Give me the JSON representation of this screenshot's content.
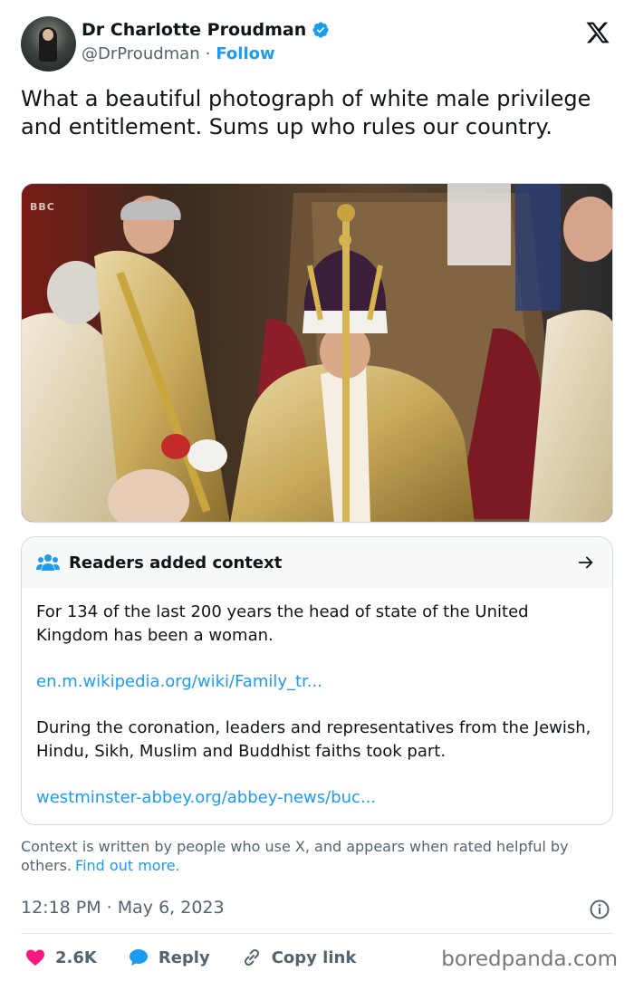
{
  "author": {
    "name": "Dr Charlotte Proudman",
    "handle": "@DrProudman",
    "separator": "·",
    "follow_label": "Follow"
  },
  "tweet": {
    "text": "What a beautiful photograph of white male privilege and entitlement. Sums up who rules our country.",
    "photo_overlay_text": "BBC"
  },
  "context": {
    "title": "Readers added context",
    "paragraph1": "For 134 of the last 200 years the head of state of the United Kingdom has been a woman.",
    "link1": "en.m.wikipedia.org/wiki/Family_tr...",
    "paragraph2": "During the coronation, leaders and representatives from the Jewish, Hindu, Sikh, Muslim and Buddhist faiths took part.",
    "link2": "westminster-abbey.org/abbey-news/buc...",
    "note": "Context is written by people who use X, and appears when rated helpful by others.",
    "find_out_more": "Find out more."
  },
  "meta": {
    "timestamp": "12:18 PM · May 6, 2023"
  },
  "actions": {
    "likes": "2.6K",
    "reply_label": "Reply",
    "copy_link_label": "Copy link"
  },
  "watermark": "boredpanda.com",
  "icons": {
    "verified": "verified-badge-icon",
    "x_logo": "x-logo-icon",
    "readers": "people-icon",
    "arrow": "arrow-right-icon",
    "info": "info-icon",
    "heart": "heart-icon",
    "reply": "speech-bubble-icon",
    "link": "link-icon"
  },
  "colors": {
    "accent": "#1d9bf0",
    "like": "#f91880",
    "muted": "#536471",
    "text": "#0f1419"
  }
}
